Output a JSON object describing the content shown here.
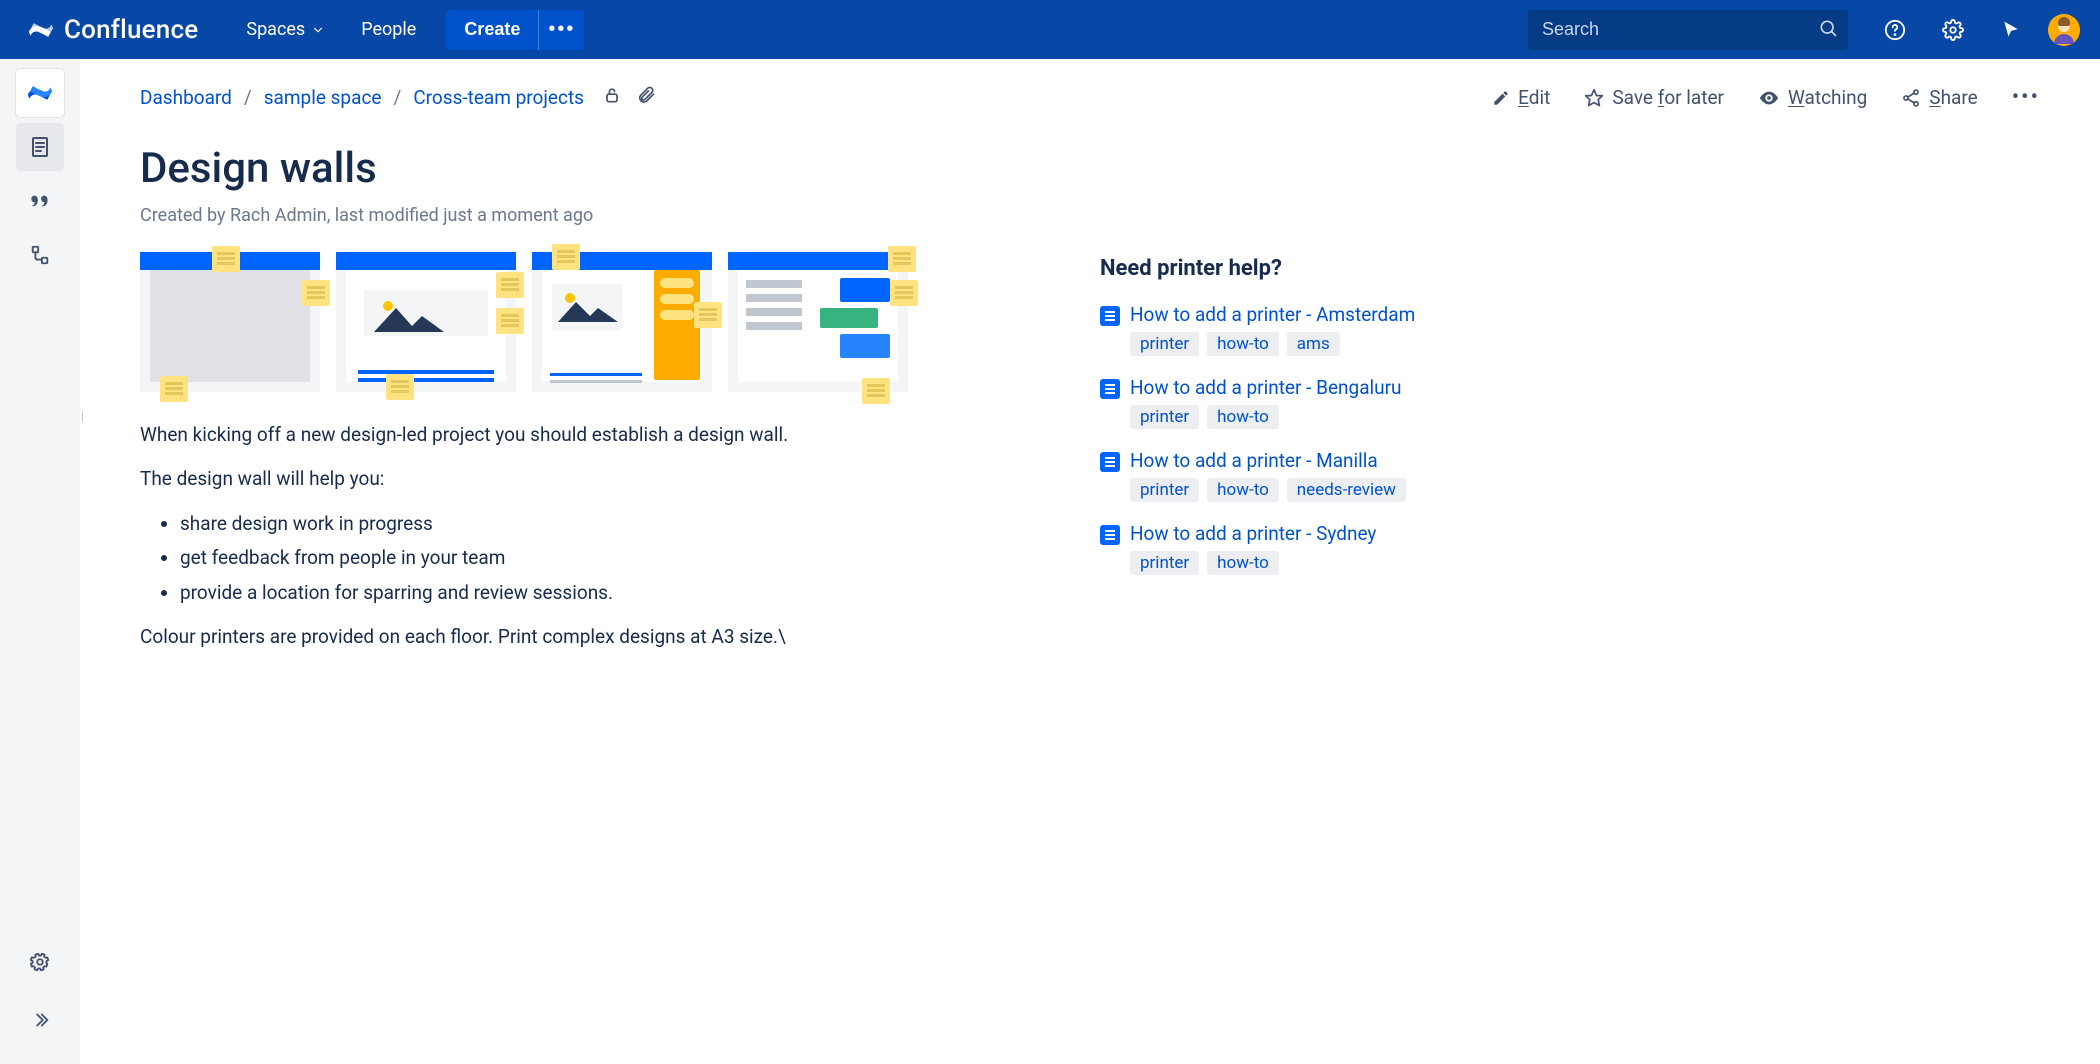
{
  "header": {
    "product": "Confluence",
    "nav": {
      "spaces": "Spaces",
      "people": "People"
    },
    "create": "Create",
    "search_placeholder": "Search"
  },
  "breadcrumbs": {
    "items": [
      "Dashboard",
      "sample space",
      "Cross-team projects"
    ]
  },
  "page_actions": {
    "edit_prefix": "E",
    "edit_rest": "dit",
    "save_prefix": "Save ",
    "save_u": "f",
    "save_rest": "or later",
    "watch_prefix": "W",
    "watch_rest": "atching",
    "share_prefix": "S",
    "share_rest": "hare"
  },
  "page": {
    "title": "Design walls",
    "byline": "Created by Rach Admin, last modified just a moment ago"
  },
  "content": {
    "p1": "When kicking off a new design-led project you should establish a design wall.",
    "p2": "The design wall will help you:",
    "bullets": [
      "share design work in progress",
      "get feedback from people in your team",
      "provide a location for sparring and review sessions."
    ],
    "p3": "Colour printers are provided on each floor. Print complex designs at A3 size.\\"
  },
  "sidebar": {
    "heading": "Need printer help?",
    "items": [
      {
        "title": "How to add a printer - Amsterdam",
        "labels": [
          "printer",
          "how-to",
          "ams"
        ]
      },
      {
        "title": "How to add a printer - Bengaluru",
        "labels": [
          "printer",
          "how-to"
        ]
      },
      {
        "title": "How to add a printer - Manilla",
        "labels": [
          "printer",
          "how-to",
          "needs-review"
        ]
      },
      {
        "title": "How to add a printer - Sydney",
        "labels": [
          "printer",
          "how-to"
        ]
      }
    ]
  }
}
